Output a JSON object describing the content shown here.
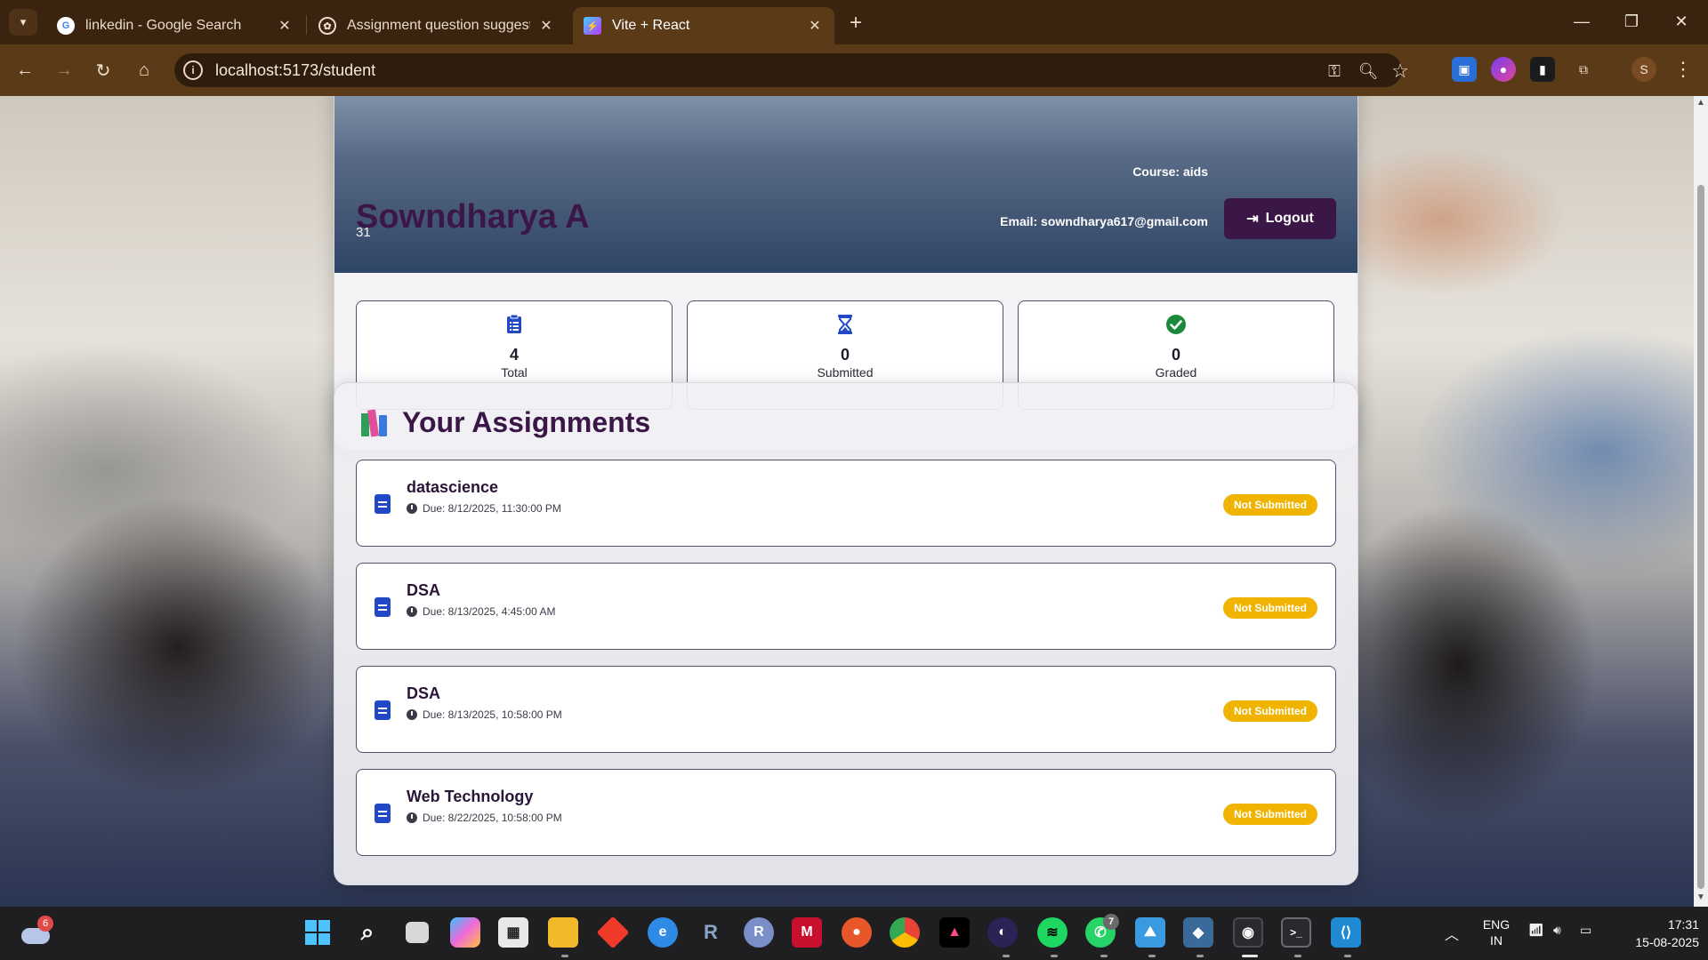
{
  "browser": {
    "tabs": [
      {
        "title": "linkedin - Google Search",
        "favicon": "google-icon"
      },
      {
        "title": "Assignment question suggestio",
        "favicon": "openai-icon"
      },
      {
        "title": "Vite + React",
        "favicon": "vite-icon",
        "active": true
      }
    ],
    "url": "localhost:5173/student",
    "profile_initial": "S"
  },
  "student": {
    "name": "Sowndharya A",
    "roll": "31",
    "course": "Course: aids",
    "email": "Email: sowndharya617@gmail.com",
    "logout_label": "Logout"
  },
  "stats": [
    {
      "value": "4",
      "label": "Total",
      "icon": "clipboard-list-icon",
      "color": "#2148c7"
    },
    {
      "value": "0",
      "label": "Submitted",
      "icon": "hourglass-icon",
      "color": "#2148c7"
    },
    {
      "value": "0",
      "label": "Graded",
      "icon": "check-circle-icon",
      "color": "#1a8a3a"
    }
  ],
  "assignments": {
    "heading": "Your Assignments",
    "items": [
      {
        "name": "datascience",
        "due": "Due: 8/12/2025, 11:30:00 PM",
        "status": "Not Submitted"
      },
      {
        "name": "DSA",
        "due": "Due: 8/13/2025, 4:45:00 AM",
        "status": "Not Submitted"
      },
      {
        "name": "DSA",
        "due": "Due: 8/13/2025, 10:58:00 PM",
        "status": "Not Submitted"
      },
      {
        "name": "Web Technology",
        "due": "Due: 8/22/2025, 10:58:00 PM",
        "status": "Not Submitted"
      }
    ],
    "badge_color": "#f0b400"
  },
  "taskbar": {
    "weather_badge": "6",
    "whatsapp_badge": "7",
    "language_line1": "ENG",
    "language_line2": "IN",
    "time": "17:31",
    "date": "15-08-2025"
  }
}
